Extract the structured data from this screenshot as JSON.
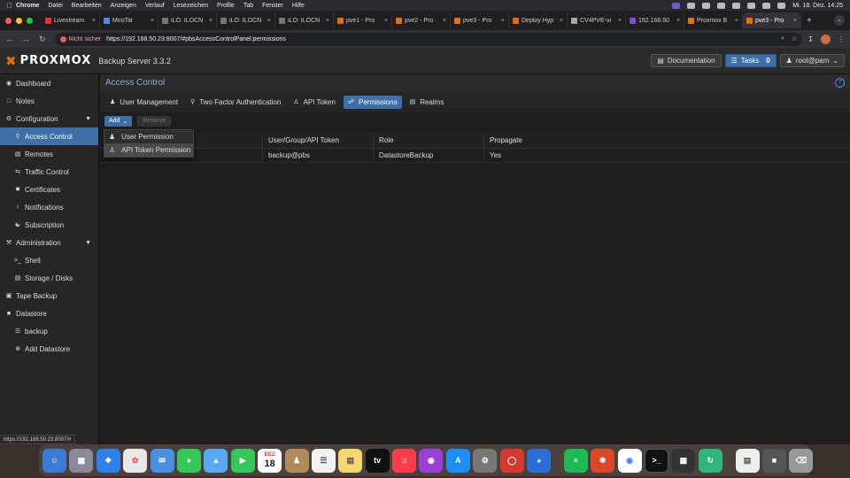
{
  "menubar": {
    "app": "Chrome",
    "items": [
      "Datei",
      "Bearbeiten",
      "Anzeigen",
      "Verlauf",
      "Lesezeichen",
      "Profile",
      "Tab",
      "Fenster",
      "Hilfe"
    ],
    "clock": "Mi. 18. Dez.  14:25"
  },
  "browser": {
    "tabs": [
      {
        "title": "Livestream",
        "color": "#e33"
      },
      {
        "title": "MiroTal",
        "color": "#4a8be0"
      },
      {
        "title": "iLO: ILOCN",
        "color": "#777"
      },
      {
        "title": "iLO: ILOCN",
        "color": "#777"
      },
      {
        "title": "iLO: ILOCN",
        "color": "#777"
      },
      {
        "title": "pve1 - Pro",
        "color": "#e57000"
      },
      {
        "title": "pve2 - Pro",
        "color": "#e57000"
      },
      {
        "title": "pve3 - Pro",
        "color": "#e57000"
      },
      {
        "title": "Deploy Hyp",
        "color": "#e57000"
      },
      {
        "title": "CV4PVE-vi",
        "color": "#aaa"
      },
      {
        "title": "192.168.50",
        "color": "#8a4fc8"
      },
      {
        "title": "Proxmox B",
        "color": "#e57000"
      },
      {
        "title": "pve3 - Pro",
        "color": "#e57000",
        "active": true
      }
    ],
    "insecure_label": "Nicht sicher",
    "url": "https://192.168.50.23:8007/#pbsAccessControlPanel:permissions",
    "status_url": "https://192.168.50.23:8007/#"
  },
  "header": {
    "logo": "PROXMOX",
    "product": "Backup Server 3.3.2",
    "documentation": "Documentation",
    "tasks": "Tasks",
    "tasks_count": "0",
    "user": "root@pam"
  },
  "sidebar": {
    "items": [
      {
        "label": "Dashboard",
        "icon": "dashboard-icon"
      },
      {
        "label": "Notes",
        "icon": "notes-icon"
      },
      {
        "label": "Configuration",
        "icon": "gears-icon"
      },
      {
        "label": "Access Control",
        "icon": "key-icon"
      },
      {
        "label": "Remotes",
        "icon": "server-icon"
      },
      {
        "label": "Traffic Control",
        "icon": "traffic-icon"
      },
      {
        "label": "Certificates",
        "icon": "certificate-icon"
      },
      {
        "label": "Notifications",
        "icon": "bell-icon"
      },
      {
        "label": "Subscription",
        "icon": "lifebuoy-icon"
      },
      {
        "label": "Administration",
        "icon": "wrench-icon"
      },
      {
        "label": "Shell",
        "icon": "terminal-icon"
      },
      {
        "label": "Storage / Disks",
        "icon": "hdd-icon"
      },
      {
        "label": "Tape Backup",
        "icon": "tape-icon"
      },
      {
        "label": "Datastore",
        "icon": "archive-icon"
      },
      {
        "label": "backup",
        "icon": "database-icon"
      },
      {
        "label": "Add Datastore",
        "icon": "plus-circle-icon"
      }
    ]
  },
  "main": {
    "title": "Access Control",
    "tabs": [
      "User Management",
      "Two Factor Authentication",
      "API Token",
      "Permissions",
      "Realms"
    ],
    "toolbar": {
      "add": "Add",
      "remove": "Remove"
    },
    "dropdown": [
      "User Permission",
      "API Token Permission"
    ],
    "columns": [
      "Path",
      "User/Group/API Token",
      "Role",
      "Propagate"
    ],
    "rows": [
      {
        "path": "",
        "user": "backup@pbs",
        "role": "DatastoreBackup",
        "propagate": "Yes"
      }
    ]
  },
  "dock": {
    "calendar_month": "DEZ",
    "calendar_day": "18"
  }
}
